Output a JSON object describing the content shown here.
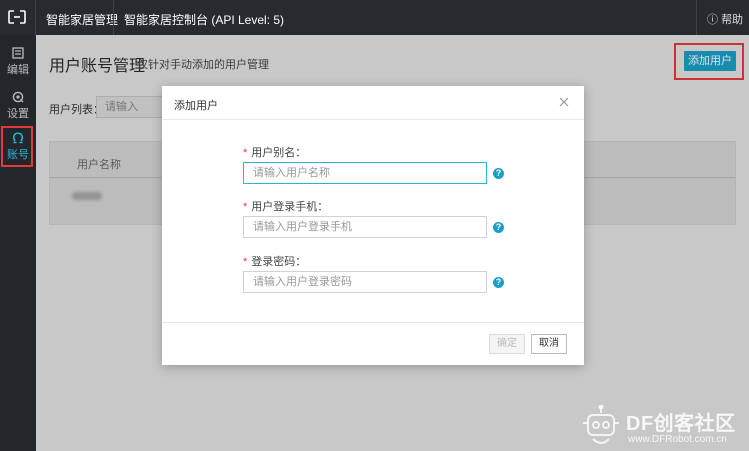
{
  "topbar": {
    "title1": "智能家居管理",
    "title2": "智能家居控制台 (API Level: 5)",
    "help_label": "帮助"
  },
  "sidebar": {
    "items": [
      {
        "label": "编辑",
        "icon": "edit-icon"
      },
      {
        "label": "设置",
        "icon": "settings-icon"
      },
      {
        "label": "账号",
        "icon": "account-icon",
        "active": true
      }
    ]
  },
  "main": {
    "title": "用户账号管理",
    "subtitle": "仅针对手动添加的用户管理",
    "add_button": "添加用户",
    "filter_label": "用户列表：",
    "filter_placeholder": "请输入",
    "table": {
      "columns": [
        "用户名称"
      ]
    }
  },
  "modal": {
    "title": "添加用户",
    "fields": [
      {
        "label": "用户别名：",
        "placeholder": "请输入用户名称"
      },
      {
        "label": "用户登录手机：",
        "placeholder": "请输入用户登录手机"
      },
      {
        "label": "登录密码：",
        "placeholder": "请输入用户登录密码"
      }
    ],
    "ok_label": "确定",
    "cancel_label": "取消"
  },
  "watermark": {
    "title": "DF创客社区",
    "url": "www.DFRobot.com.cn"
  },
  "colors": {
    "accent": "#1aa0c6",
    "highlight": "#e53935",
    "topbar": "#262b30"
  }
}
